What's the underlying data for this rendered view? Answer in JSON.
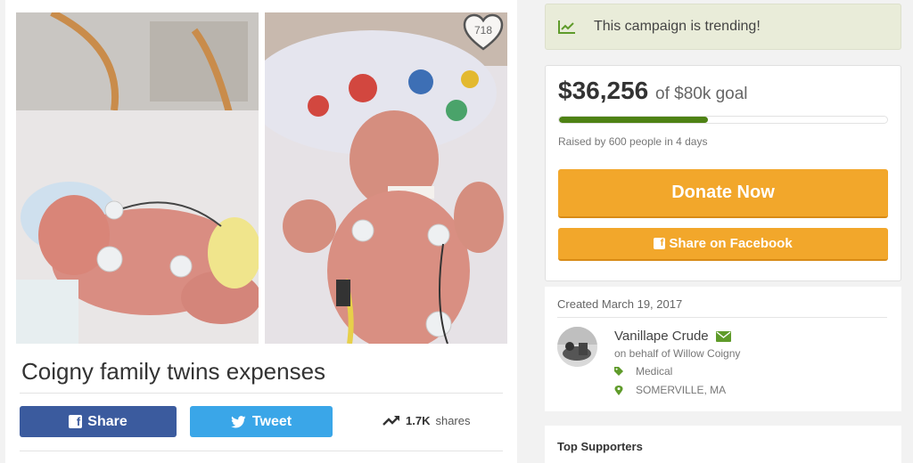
{
  "campaign": {
    "title": "Coigny family twins expenses",
    "heart_count": "718"
  },
  "social": {
    "share_label": "Share",
    "tweet_label": "Tweet",
    "shares_count": "1.7K",
    "shares_label": "shares"
  },
  "trending": {
    "text": "This campaign is trending!",
    "icon": "trend-chart-icon"
  },
  "donation": {
    "raised": "$36,256",
    "goal": "of $80k goal",
    "progress_fraction": 0.4532,
    "raised_by": "Raised by 600 people in 4 days",
    "donate_label": "Donate Now",
    "share_fb_label": "Share on Facebook"
  },
  "organizer": {
    "created": "Created March 19, 2017",
    "name": "Vanillape Crude",
    "behalf": "on behalf of Willow Coigny",
    "category": "Medical",
    "location": "SOMERVILLE, MA"
  },
  "supporters": {
    "title": "Top Supporters"
  },
  "colors": {
    "facebook": "#3b5b9e",
    "twitter": "#3aa6e8",
    "donate": "#f2a72b",
    "progress": "#4e8214",
    "trending_bg": "#e9ecd9",
    "accent_green": "#5f9b2a"
  }
}
